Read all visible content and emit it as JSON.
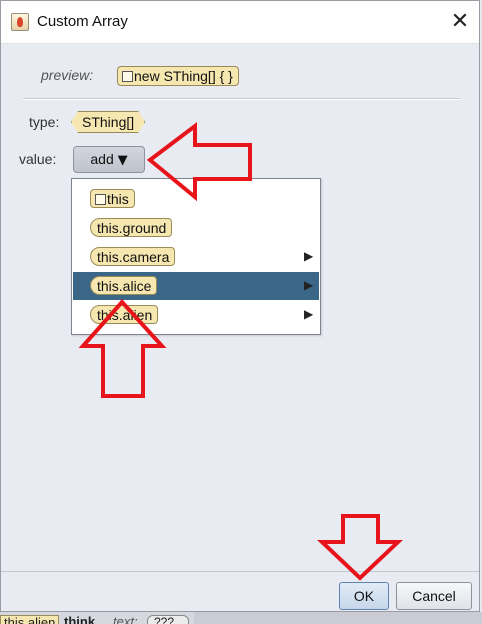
{
  "window": {
    "title": "Custom Array",
    "close_glyph": "✕",
    "icon": "java-cup-icon"
  },
  "preview": {
    "label": "preview:",
    "tile_text": "new SThing[] { }"
  },
  "type": {
    "label": "type:",
    "value": "SThing[]"
  },
  "value": {
    "label": "value:",
    "add_button_label": "add",
    "caret": "▼"
  },
  "menu": {
    "items": [
      {
        "label": "this",
        "has_submenu": false,
        "selected": false
      },
      {
        "label": "this.ground",
        "has_submenu": false,
        "selected": false
      },
      {
        "label": "this.camera",
        "has_submenu": true,
        "selected": false
      },
      {
        "label": "this.alice",
        "has_submenu": true,
        "selected": true
      },
      {
        "label": "this.alien",
        "has_submenu": true,
        "selected": false
      }
    ],
    "submenu_arrow": "▶"
  },
  "buttons": {
    "ok": "OK",
    "cancel": "Cancel"
  },
  "background": {
    "tile": "this.alien",
    "method": "think",
    "param_label": "text:",
    "param_value": "???"
  },
  "colors": {
    "selection": "#3a6687",
    "tile_fill": "#f6e6b0",
    "annotation_arrows": "#e8141b"
  }
}
